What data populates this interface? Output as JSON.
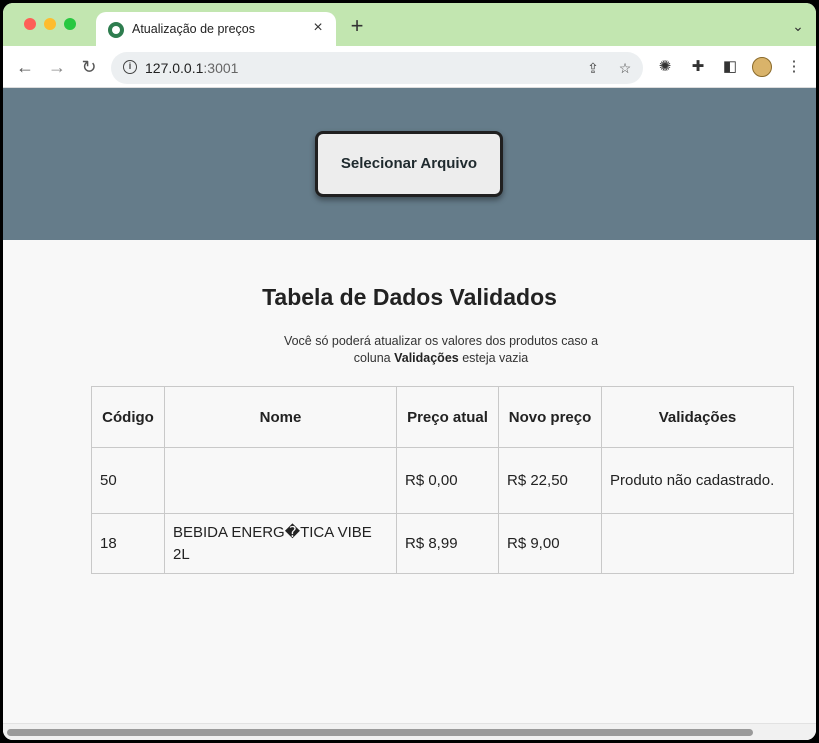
{
  "browser": {
    "tab_title": "Atualização de preços",
    "tab_close": "×",
    "new_tab": "+",
    "url_host": "127.0.0.1",
    "url_port": ":3001"
  },
  "hero": {
    "select_button": "Selecionar Arquivo"
  },
  "main": {
    "title": "Tabela de Dados Validados",
    "subtitle_before": "Você só poderá atualizar os valores dos produtos caso a coluna ",
    "subtitle_bold": "Validações",
    "subtitle_after": " esteja vazia"
  },
  "table": {
    "headers": [
      "Código",
      "Nome",
      "Preço atual",
      "Novo preço",
      "Validações"
    ],
    "rows": [
      [
        "50",
        "",
        "R$ 0,00",
        "R$ 22,50",
        "Produto não cadastrado."
      ],
      [
        "18",
        "BEBIDA ENERG�TICA VIBE 2L",
        "R$ 8,99",
        "R$ 9,00",
        ""
      ]
    ]
  },
  "colors": {
    "hero_bg": "#657c8a",
    "tabstrip_bg": "#c2e6b0",
    "page_bg": "#f8f8f8"
  },
  "icons": [
    "back-icon",
    "forward-icon",
    "reload-icon",
    "info-icon",
    "share-icon",
    "star-icon",
    "bug-icon",
    "extensions-icon",
    "sidepanel-icon",
    "profile-avatar",
    "menu-icon"
  ]
}
